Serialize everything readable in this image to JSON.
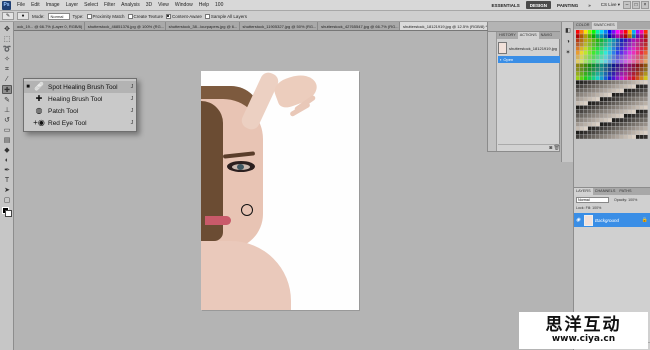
{
  "app": {
    "logo": "Ps",
    "menu": [
      "File",
      "Edit",
      "Image",
      "Layer",
      "Select",
      "Filter",
      "Analysis",
      "3D",
      "View",
      "Window",
      "Help"
    ],
    "zoom": "100",
    "workspaces": [
      "ESSENTIALS",
      "DESIGN",
      "PAINTING"
    ],
    "active_workspace": "DESIGN",
    "more": "»",
    "cs_live": "CS Live ▾"
  },
  "options": {
    "mode_label": "Mode:",
    "mode_value": "Normal",
    "type_label": "Type:",
    "proximity_match": "Proximity Match",
    "create_texture": "Create Texture",
    "content_aware": "Content-Aware",
    "sample_all_layers": "Sample All Layers"
  },
  "tabs": [
    {
      "label": "ock_19... @ 66.7% (Layer 0, RGB/8)"
    },
    {
      "label": "shutterstock_46851376.jpg @ 100% (RG..."
    },
    {
      "label": "shutterstock_38...lourpapers.jpg @ 6..."
    },
    {
      "label": "shutterstock_11905327.jpg @ 50% (RG..."
    },
    {
      "label": "shutterstock_42765547.jpg @ 66.7% (RG..."
    },
    {
      "label": "shutterstock_18121919.jpg @ 12.5% (RGB/8) *"
    }
  ],
  "flyout": {
    "items": [
      {
        "label": "Spot Healing Brush Tool",
        "key": "J",
        "icon": "band-aid-icon",
        "active": true
      },
      {
        "label": "Healing Brush Tool",
        "key": "J",
        "icon": "healing-brush-icon",
        "active": false
      },
      {
        "label": "Patch Tool",
        "key": "J",
        "icon": "patch-icon",
        "active": false
      },
      {
        "label": "Red Eye Tool",
        "key": "J",
        "icon": "red-eye-icon",
        "active": false
      }
    ]
  },
  "history": {
    "tabs": [
      "HISTORY",
      "ACTIONS",
      "NAVIG"
    ],
    "snapshot": "shutterstock_18121919.jpg",
    "step": "Open"
  },
  "right_dock": {
    "swatch_tabs": [
      "COLOR",
      "SWATCHES"
    ],
    "layers_tabs": [
      "LAYERS",
      "CHANNELS",
      "PATHS"
    ],
    "blend_mode": "Normal",
    "opacity": "Opacity: 100%",
    "lock": "Lock: Fill: 100%",
    "layer_name": "Background"
  },
  "watermark": {
    "cn": "思洋互动",
    "url": "www.ciya.cn"
  }
}
